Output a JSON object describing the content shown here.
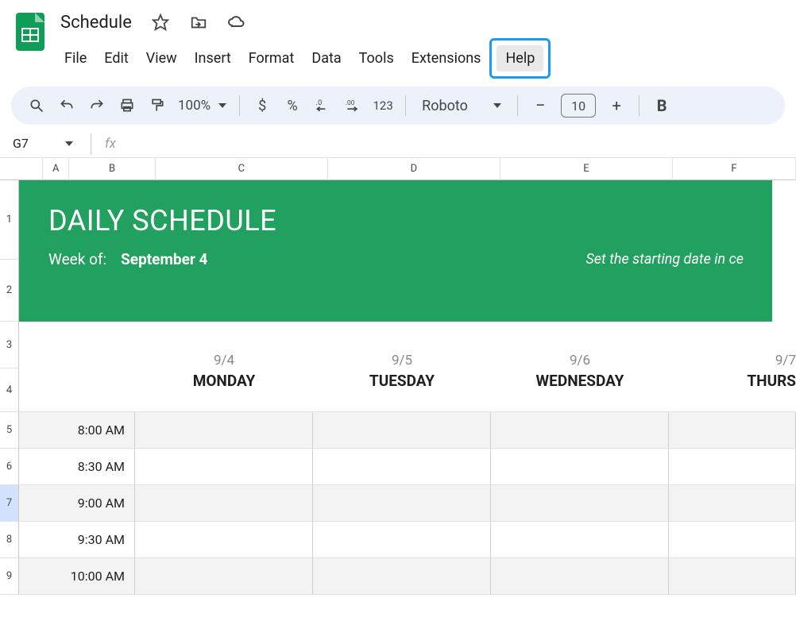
{
  "doc": {
    "title": "Schedule"
  },
  "menus": {
    "file": "File",
    "edit": "Edit",
    "view": "View",
    "insert": "Insert",
    "format": "Format",
    "data": "Data",
    "tools": "Tools",
    "extensions": "Extensions",
    "help": "Help"
  },
  "toolbar": {
    "zoom": "100%",
    "currency": "$",
    "percent": "%",
    "decrease_dec": ".0",
    "increase_dec": ".00",
    "num_fmt": "123",
    "font_name": "Roboto",
    "font_size": "10",
    "bold": "B"
  },
  "namebox": {
    "cell": "G7"
  },
  "fx": {
    "label": "fx"
  },
  "columns": {
    "A": "A",
    "B": "B",
    "C": "C",
    "D": "D",
    "E": "E",
    "F": "F"
  },
  "rows": [
    "1",
    "2",
    "3",
    "4",
    "5",
    "6",
    "7",
    "8",
    "9"
  ],
  "selected_row_index": 6,
  "banner": {
    "title": "DAILY SCHEDULE",
    "week_label": "Week of:",
    "week_value": "September 4",
    "hint": "Set the starting date in ce"
  },
  "days": [
    {
      "date": "9/4",
      "name": "MONDAY"
    },
    {
      "date": "9/5",
      "name": "TUESDAY"
    },
    {
      "date": "9/6",
      "name": "WEDNESDAY"
    },
    {
      "date": "9/7",
      "name": "THURS"
    }
  ],
  "times": [
    "8:00 AM",
    "8:30 AM",
    "9:00 AM",
    "9:30 AM",
    "10:00 AM"
  ],
  "row_heights": {
    "r1": 100,
    "r2": 78,
    "r3": 59,
    "r4": 55,
    "r5": 46,
    "r6": 46,
    "r7": 46,
    "r8": 46,
    "r9": 46
  }
}
